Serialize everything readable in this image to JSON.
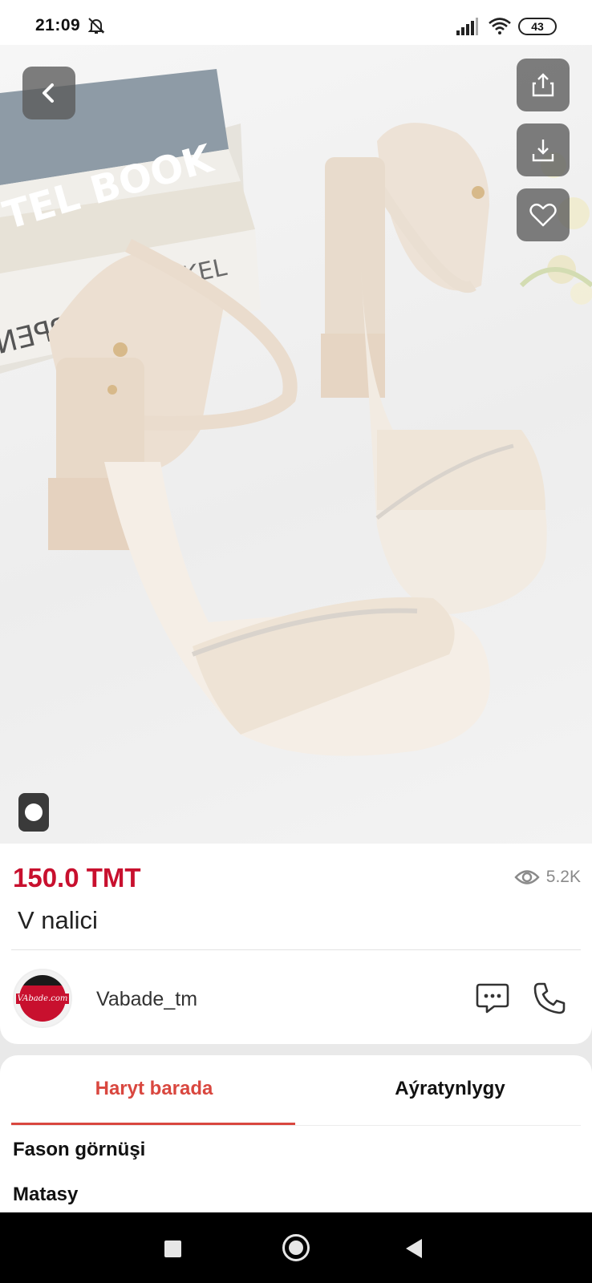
{
  "status_bar": {
    "time": "21:09",
    "battery": "43",
    "icons": [
      "bell-muted-icon",
      "signal-icon",
      "wifi-icon",
      "battery-icon"
    ]
  },
  "product_image": {
    "top_actions": [
      "back-icon",
      "share-icon",
      "download-icon",
      "heart-icon"
    ],
    "gallery_indicator": "dot-icon",
    "book_spine_text": "TEL BOOK",
    "book_cover_text": "KEL",
    "book_lower_text": "ENPPEN"
  },
  "product": {
    "price": "150.0 TMT",
    "views": "5.2K",
    "title": "V nalici"
  },
  "seller": {
    "name": "Vabade_tm",
    "avatar_text": "VAbade.com",
    "actions": [
      "chat-icon",
      "phone-icon"
    ]
  },
  "tabs": {
    "active": "Haryt barada",
    "items": [
      "Haryt barada",
      "Aýratynlygy"
    ]
  },
  "details": {
    "rows": [
      "Fason görnüşi",
      "Matasy"
    ]
  },
  "colors": {
    "price": "#c8102e",
    "accent": "#d9473f",
    "overlay_button": "#5a5a5a"
  },
  "nav": {
    "buttons": [
      "recent-apps-icon",
      "home-icon",
      "back-nav-icon"
    ]
  }
}
